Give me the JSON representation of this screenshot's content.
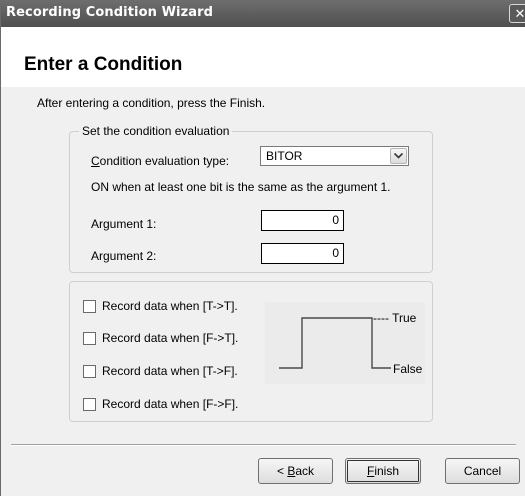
{
  "window": {
    "title": "Recording Condition Wizard",
    "close_glyph": "✕"
  },
  "page": {
    "heading": "Enter a Condition",
    "instruction": "After entering a condition, press the Finish."
  },
  "evaluation_group": {
    "legend": "Set the condition evaluation",
    "type_label_first": "C",
    "type_label_rest": "ondition evaluation type:",
    "type_value": "BITOR",
    "description": "ON when at least one bit is the same as the argument 1.",
    "argument1_label": "Argument 1:",
    "argument1_value": "0",
    "argument2_label": "Argument 2:",
    "argument2_value": "0"
  },
  "record_group": {
    "options": [
      {
        "label": "Record data when [T->T].",
        "checked": false
      },
      {
        "label": "Record data when [F->T].",
        "checked": false
      },
      {
        "label": "Record data when [T->F].",
        "checked": false
      },
      {
        "label": "Record data when [F->F].",
        "checked": false
      }
    ],
    "diagram": {
      "true_label": "---- True",
      "false_label": "False"
    }
  },
  "buttons": {
    "back_prefix": "< ",
    "back_mnemonic": "B",
    "back_rest": "ack",
    "finish_mnemonic": "F",
    "finish_rest": "inish",
    "cancel": "Cancel"
  },
  "icons": {
    "dropdown": "chevron-down-icon",
    "close": "close-icon"
  }
}
